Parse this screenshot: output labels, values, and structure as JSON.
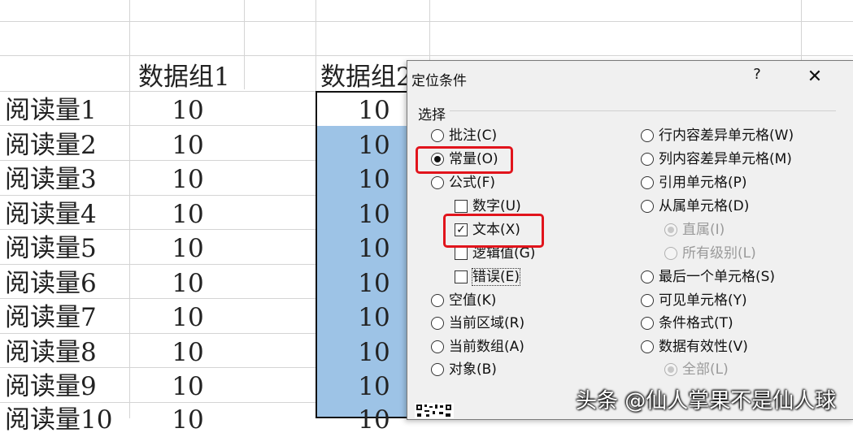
{
  "sheet": {
    "headers": [
      "数据组1",
      "数据组2"
    ],
    "row_labels": [
      "阅读量1",
      "阅读量2",
      "阅读量3",
      "阅读量4",
      "阅读量5",
      "阅读量6",
      "阅读量7",
      "阅读量8",
      "阅读量9",
      "阅读量10"
    ],
    "col1_values": [
      "10",
      "10",
      "10",
      "10",
      "10",
      "10",
      "10",
      "10",
      "10",
      "10"
    ],
    "col2_values": [
      "10",
      "10",
      "10",
      "10",
      "10",
      "10",
      "10",
      "10",
      "10",
      "10"
    ],
    "selection_color": "#9dc3e6"
  },
  "dialog": {
    "title": "定位条件",
    "help": "?",
    "close": "✕",
    "group_label": "选择",
    "left_options": [
      {
        "label": "批注(C)",
        "type": "radio",
        "checked": false
      },
      {
        "label": "常量(O)",
        "type": "radio",
        "checked": true
      },
      {
        "label": "公式(F)",
        "type": "radio",
        "checked": false
      },
      {
        "label": "数字(U)",
        "type": "checkbox",
        "checked": false
      },
      {
        "label": "文本(X)",
        "type": "checkbox",
        "checked": true
      },
      {
        "label": "逻辑值(G)",
        "type": "checkbox",
        "checked": false
      },
      {
        "label": "错误(E)",
        "type": "checkbox",
        "checked": false
      },
      {
        "label": "空值(K)",
        "type": "radio",
        "checked": false
      },
      {
        "label": "当前区域(R)",
        "type": "radio",
        "checked": false
      },
      {
        "label": "当前数组(A)",
        "type": "radio",
        "checked": false
      },
      {
        "label": "对象(B)",
        "type": "radio",
        "checked": false
      }
    ],
    "right_options": [
      {
        "label": "行内容差异单元格(W)",
        "type": "radio",
        "checked": false,
        "disabled": false
      },
      {
        "label": "列内容差异单元格(M)",
        "type": "radio",
        "checked": false,
        "disabled": false
      },
      {
        "label": "引用单元格(P)",
        "type": "radio",
        "checked": false,
        "disabled": false
      },
      {
        "label": "从属单元格(D)",
        "type": "radio",
        "checked": false,
        "disabled": false
      },
      {
        "label": "直属(I)",
        "type": "radio",
        "checked": true,
        "disabled": true
      },
      {
        "label": "所有级别(L)",
        "type": "radio",
        "checked": false,
        "disabled": true
      },
      {
        "label": "最后一个单元格(S)",
        "type": "radio",
        "checked": false,
        "disabled": false
      },
      {
        "label": "可见单元格(Y)",
        "type": "radio",
        "checked": false,
        "disabled": false
      },
      {
        "label": "条件格式(T)",
        "type": "radio",
        "checked": false,
        "disabled": false
      },
      {
        "label": "数据有效性(V)",
        "type": "radio",
        "checked": false,
        "disabled": false
      },
      {
        "label": "全部(L)",
        "type": "radio",
        "checked": true,
        "disabled": true
      }
    ],
    "highlight_color": "#e1141c"
  },
  "watermark": "头条 @仙人掌果不是仙人球"
}
